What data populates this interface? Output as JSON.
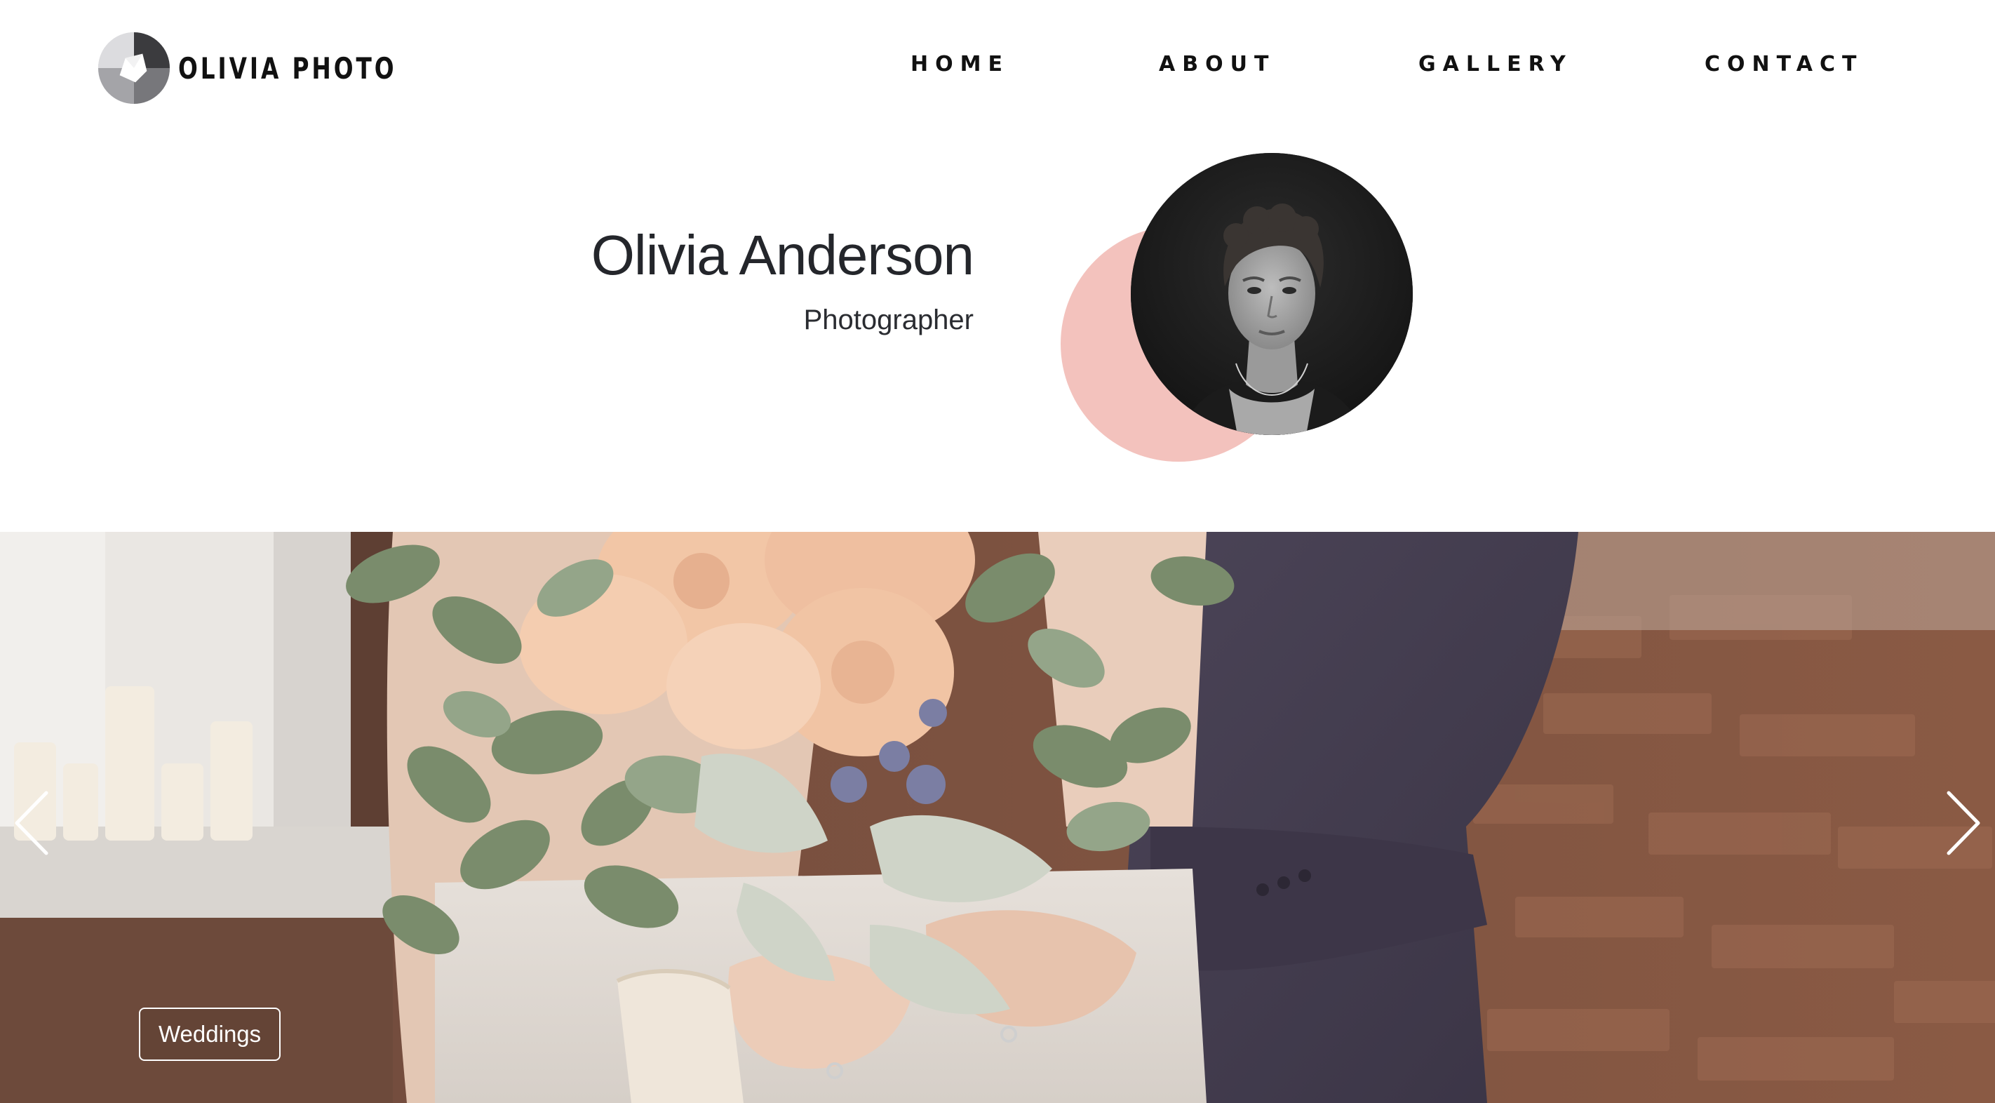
{
  "brand": {
    "name": "OLIVIA PHOTO",
    "logo_icon": "camera-aperture-icon"
  },
  "nav": {
    "items": [
      {
        "label": "HOME"
      },
      {
        "label": "ABOUT"
      },
      {
        "label": "GALLERY"
      },
      {
        "label": "CONTACT"
      }
    ]
  },
  "profile": {
    "name": "Olivia Anderson",
    "role": "Photographer",
    "accent_color": "#f3c2bd"
  },
  "slider": {
    "category": "Weddings",
    "prev_icon": "chevron-left-icon",
    "next_icon": "chevron-right-icon"
  }
}
